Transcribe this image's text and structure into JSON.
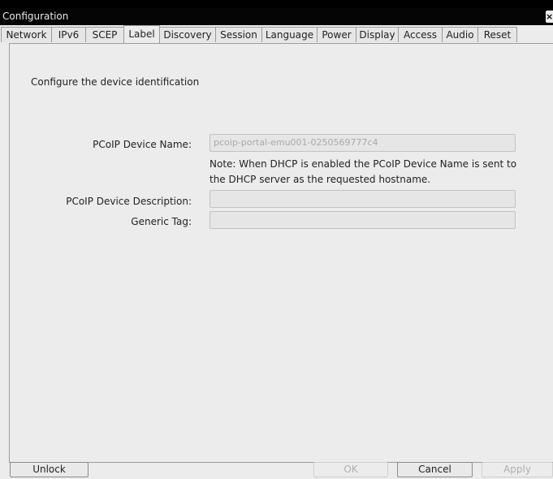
{
  "window": {
    "title": "Configuration",
    "close_label": "×"
  },
  "tabs": [
    {
      "label": "Network",
      "active": false
    },
    {
      "label": "IPv6",
      "active": false
    },
    {
      "label": "SCEP",
      "active": false
    },
    {
      "label": "Label",
      "active": true
    },
    {
      "label": "Discovery",
      "active": false
    },
    {
      "label": "Session",
      "active": false
    },
    {
      "label": "Language",
      "active": false
    },
    {
      "label": "Power",
      "active": false
    },
    {
      "label": "Display",
      "active": false
    },
    {
      "label": "Access",
      "active": false
    },
    {
      "label": "Audio",
      "active": false
    },
    {
      "label": "Reset",
      "active": false
    }
  ],
  "label_page": {
    "intro": "Configure the device identification",
    "device_name_label": "PCoIP Device Name:",
    "device_name_value": "pcoip-portal-emu001-0250569777c4",
    "note_line1": "Note: When DHCP is enabled the PCoIP Device Name is sent to",
    "note_line2": "the DHCP server as the requested hostname.",
    "description_label": "PCoIP Device Description:",
    "description_value": "",
    "generic_tag_label": "Generic Tag:",
    "generic_tag_value": ""
  },
  "buttons": {
    "unlock": "Unlock",
    "ok": "OK",
    "cancel": "Cancel",
    "apply": "Apply"
  }
}
